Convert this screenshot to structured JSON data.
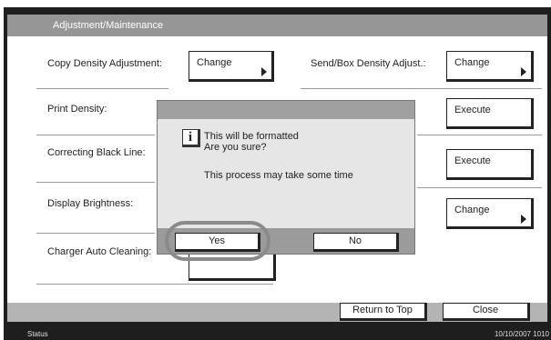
{
  "header": {
    "title": "Adjustment/Maintenance"
  },
  "settings": {
    "copy_density": {
      "label": "Copy Density Adjustment:",
      "button": "Change"
    },
    "send_box_density": {
      "label": "Send/Box Density Adjust.:",
      "button": "Change"
    },
    "print_density": {
      "label": "Print Density:",
      "button": "Execute"
    },
    "correcting_black_line": {
      "label": "Correcting Black Line:",
      "button": "Execute"
    },
    "display_brightness": {
      "label": "Display Brightness:",
      "button": "Change"
    },
    "charger_auto_cleaning": {
      "label": "Charger Auto Cleaning:"
    }
  },
  "dialog": {
    "icon": "info-icon",
    "line1": "This will be formatted",
    "line2": "Are you sure?",
    "line3": "This process may take some time",
    "yes": "Yes",
    "no": "No"
  },
  "footer": {
    "return_to_top": "Return to Top",
    "close": "Close"
  },
  "status_bar": {
    "status": "Status",
    "datetime": "10/10/2007  1010"
  },
  "colors": {
    "header": "#969696",
    "dialog_bg": "#e6e6e6",
    "dialog_bars": "#9b9b9b",
    "frame": "#1e1e1e"
  }
}
